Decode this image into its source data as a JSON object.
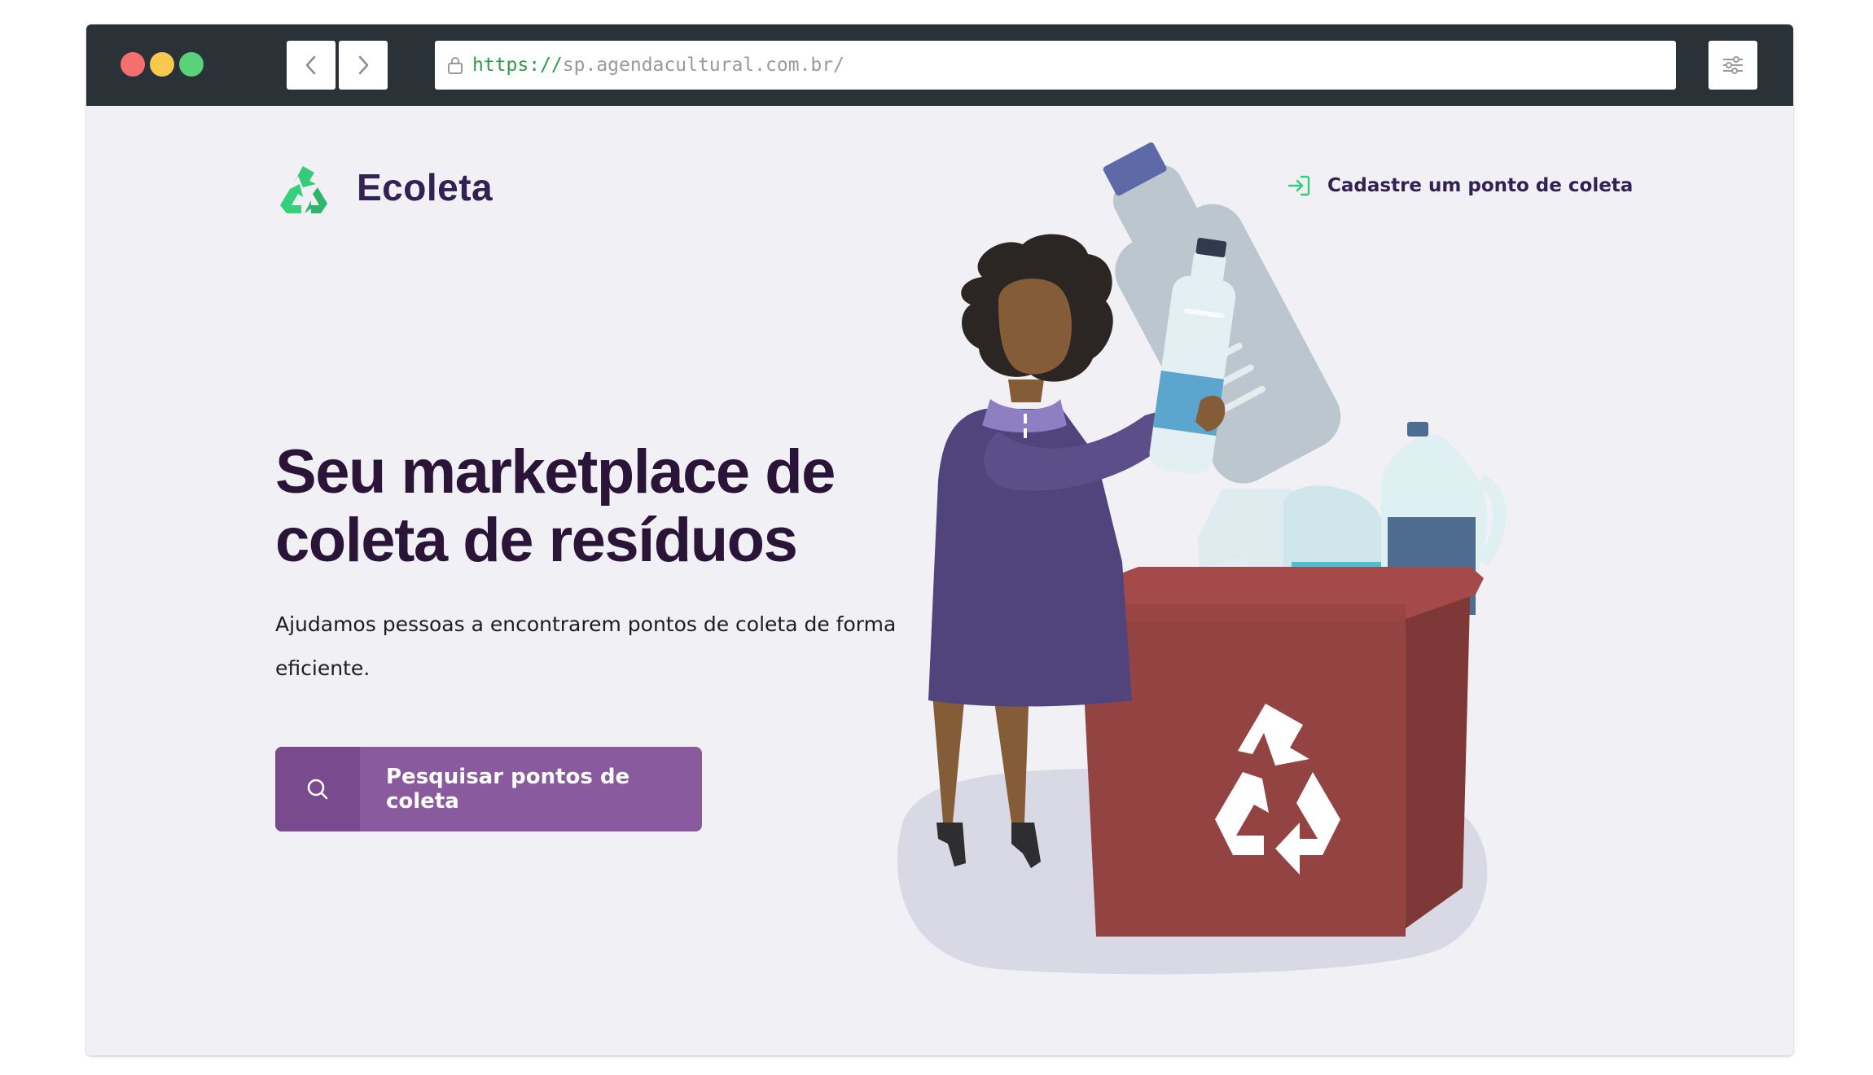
{
  "browser": {
    "url_scheme": "https://",
    "url_host": "sp.agendacultural.com.br/"
  },
  "header": {
    "logo_text": "Ecoleta",
    "register_label": "Cadastre um ponto de coleta"
  },
  "hero": {
    "title_line1": "Seu marketplace de",
    "title_line2": "coleta de resíduos",
    "subtitle_line1": "Ajudamos pessoas a encontrarem pontos de coleta de forma",
    "subtitle_line2": "eficiente.",
    "cta_label": "Pesquisar pontos de coleta"
  },
  "colors": {
    "brand_purple": "#322153",
    "cta": "#8a5a9e",
    "accent_green": "#34cb79",
    "background": "#f0f0f5"
  }
}
